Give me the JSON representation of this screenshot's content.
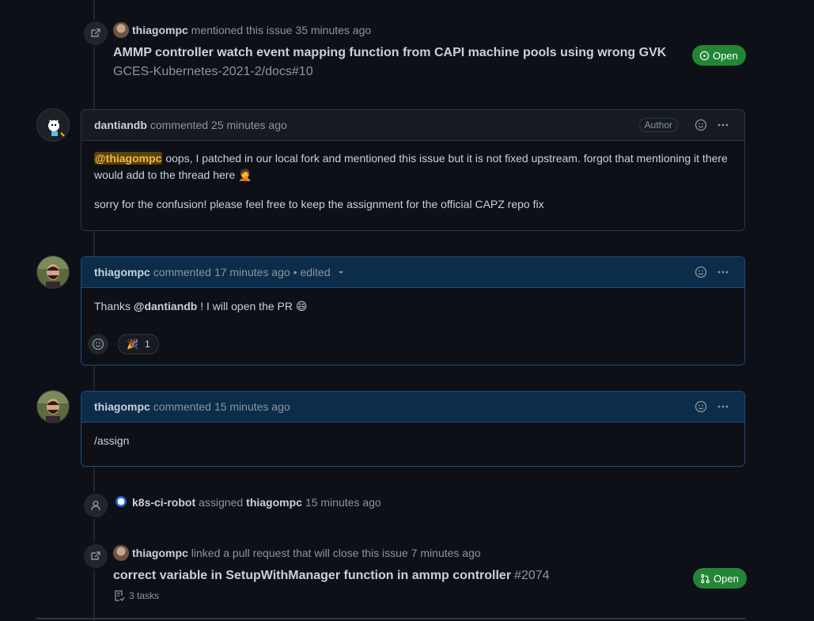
{
  "events": {
    "cross_ref_1": {
      "user": "thiagompc",
      "action": "mentioned this issue",
      "time": "35 minutes ago",
      "title": "AMMP controller watch event mapping function from CAPI machine pools using wrong GVK",
      "subtitle": "GCES-Kubernetes-2021-2/docs#10",
      "state": "Open"
    },
    "assigned": {
      "actor": "k8s-ci-robot",
      "action": "assigned",
      "assignee": "thiagompc",
      "time": "15 minutes ago"
    },
    "cross_ref_2": {
      "user": "thiagompc",
      "action": "linked a pull request that will close this issue",
      "time": "7 minutes ago",
      "title": "correct variable in SetupWithManager function in ammp controller",
      "number": "#2074",
      "tasks": "3 tasks",
      "state": "Open"
    }
  },
  "comments": [
    {
      "author": "dantiandb",
      "verb": "commented",
      "time": "25 minutes ago",
      "label": "Author",
      "mention": "@thiagompc",
      "p1_rest": " oops, I patched in our local fork and mentioned this issue but it is not fixed upstream. forgot that mentioning it there would add to the thread here 🤦",
      "p2": "sorry for the confusion! please feel free to keep the assignment for the official CAPZ repo fix"
    },
    {
      "author": "thiagompc",
      "verb": "commented",
      "time": "17 minutes ago",
      "edited": "• edited",
      "pre": "Thanks ",
      "mention": "@dantiandb",
      "post": " ! I will open the PR 😄",
      "reaction_emoji": "🎉",
      "reaction_count": "1"
    },
    {
      "author": "thiagompc",
      "verb": "commented",
      "time": "15 minutes ago",
      "body": "/assign"
    }
  ],
  "colors": {
    "background": "#0d1117",
    "open_green": "#238636",
    "mention_highlight": "#5b4110",
    "self_comment_header": "#0c2d4a"
  }
}
